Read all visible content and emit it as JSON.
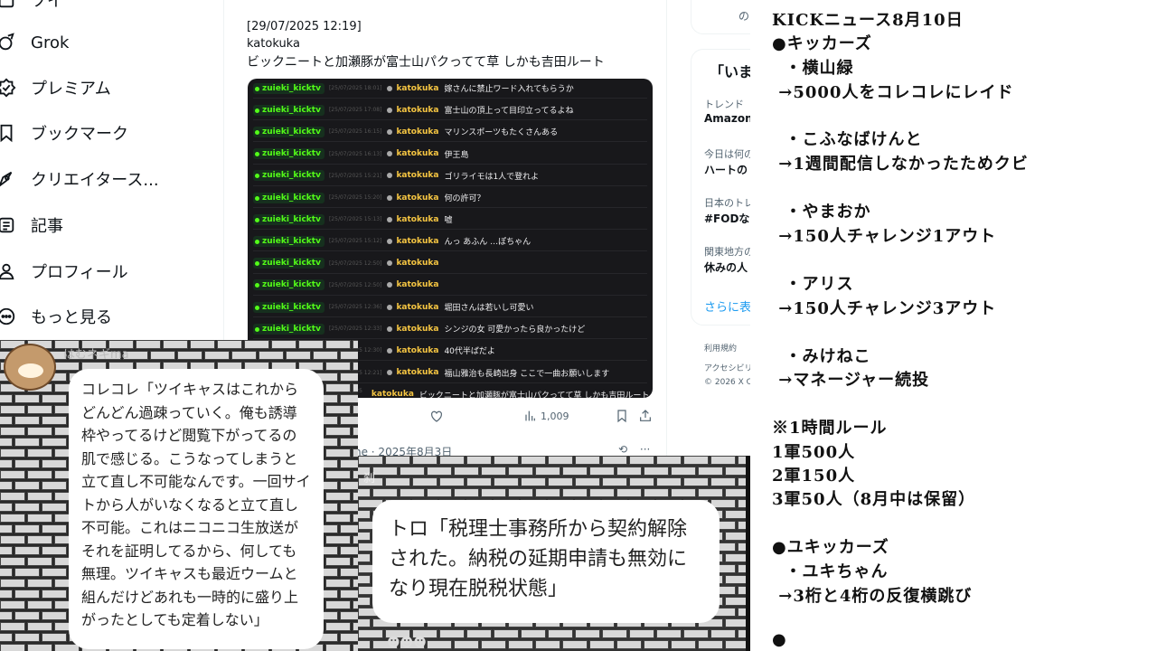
{
  "nav": {
    "items": [
      {
        "label": "Grok",
        "icon": "grok-icon"
      },
      {
        "label": "プレミアム",
        "icon": "premium-icon"
      },
      {
        "label": "ブックマーク",
        "icon": "bookmark-icon"
      },
      {
        "label": "クリエイタース...",
        "icon": "creator-studio-icon"
      },
      {
        "label": "記事",
        "icon": "articles-icon"
      },
      {
        "label": "プロフィール",
        "icon": "profile-icon"
      },
      {
        "label": "もっと見る",
        "icon": "more-icon"
      }
    ]
  },
  "post": {
    "timestamp": "[29/07/2025 12:19]",
    "username": "katokuka",
    "text": "ビックニートと加瀬豚が富士山パクってて草 しかも吉田ルート",
    "views": "1,009",
    "next_line": "ne · 2025年8月3日"
  },
  "chat": {
    "channel": "zuieki_kicktv",
    "user": "katokuka",
    "rows": [
      {
        "date": "[25/07/2025 18:01]",
        "msg": "嫁さんに禁止ワード入れてもらうか"
      },
      {
        "date": "[25/07/2025 17:08]",
        "msg": "富士山の頂上って目印立ってるよね"
      },
      {
        "date": "[25/07/2025 16:15]",
        "msg": "マリンスポーツもたくさんある"
      },
      {
        "date": "[25/07/2025 16:13]",
        "msg": "伊王島"
      },
      {
        "date": "[25/07/2025 15:21]",
        "msg": "ゴリライモは1人で登れよ"
      },
      {
        "date": "[25/07/2025 15:20]",
        "msg": "何の許可？"
      },
      {
        "date": "[25/07/2025 15:13]",
        "msg": "嘘"
      },
      {
        "date": "[25/07/2025 15:12]",
        "msg": "んっ あふん …ぽちゃん"
      },
      {
        "date": "[25/07/2025 12:50]",
        "msg": ""
      },
      {
        "date": "[25/07/2025 12:50]",
        "msg": ""
      },
      {
        "date": "[25/07/2025 12:36]",
        "msg": "堀田さんは若いし可愛い"
      },
      {
        "date": "[25/07/2025 12:33]",
        "msg": "シンジの女 可愛かったら良かったけど"
      },
      {
        "date": "[25/07/2025 12:30]",
        "msg": "40代半ばだよ"
      },
      {
        "date": "[25/07/2025 12:21]",
        "msg": "福山雅治も長崎出身 ここで一曲お願いします"
      },
      {
        "date": "[25/07/2025 12:19]",
        "msg": "ビックニートと加瀬豚が富士山パクってて草 しかも吉田ルート"
      }
    ]
  },
  "right_sidebar": {
    "top_fragment": "の",
    "heading": "「いま",
    "trend_label": "トレンド",
    "trend1": "Amazon",
    "sub2": "今日は何の",
    "trend2": "ハートの",
    "sub3": "日本のトレ",
    "trend3": "#FODな",
    "sub4": "関東地方の",
    "trend4": "休みの人",
    "more": "さらに表",
    "footer1": "利用規約",
    "footer2": "アクセシビリ",
    "footer3": "© 2026 X Co"
  },
  "doc": {
    "lines": [
      "KICKニュース8月10日",
      "●キッカーズ",
      "  ・横山緑",
      " →5000人をコレコレにレイド",
      "  ・こふなばけんと",
      " →1週間配信しなかったためクビ",
      "  ・やまおか",
      " →150人チャレンジ1アウト",
      "  ・アリス",
      " →150人チャレンジ3アウト",
      "  ・みけねこ",
      " →マネージャー続投",
      "※1時間ルール",
      "1軍500人",
      "2軍150人",
      "3軍50人（8月中は保留）",
      "●ユキッカーズ",
      "  ・ユキちゃん",
      " →3桁と4桁の反復横跳び",
      "●"
    ]
  },
  "bubble_left": {
    "username": "はむネギma",
    "text": "コレコレ「ツイキャスはこれからどんどん過疎っていく。俺も誘導枠やってるけど閲覧下がってるの肌で感じる。こうなってしまうと立て直し不可能なんです。一回サイトから人がいなくなると立て直し不可能。これはニコニコ生放送がそれを証明してるから、何しても無理。ツイキャスも最近ウームと組んだけどあれも一時的に盛り上がったとしても定着しない」"
  },
  "bubble_mid": {
    "tag": "刹",
    "text": "トロ「税理士事務所から契約解除された。納税の延期申請も無効になり現在脱税状態」"
  },
  "colors": {
    "kick_green": "#53fc18",
    "chat_bg": "#18181b",
    "username_yellow": "#f5c542",
    "link_blue": "#1d9bf0"
  }
}
